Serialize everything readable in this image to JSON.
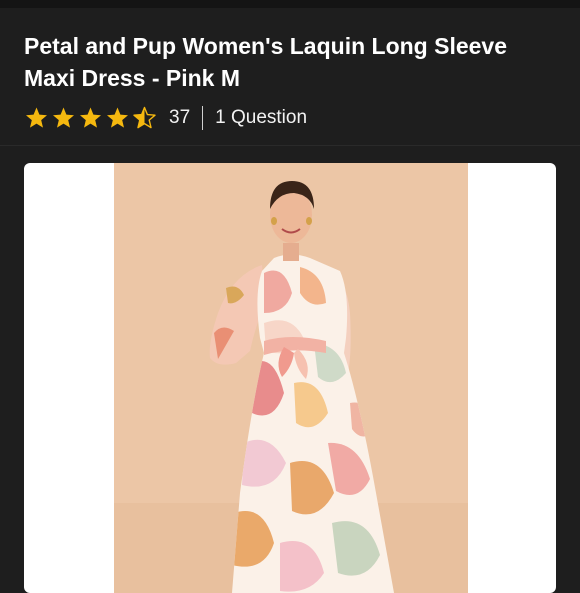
{
  "product": {
    "title": "Petal and Pup Women's Laquin Long Sleeve Maxi Dress - Pink M",
    "rating_stars": 4.5,
    "rating_count": "37",
    "questions": "1 Question"
  },
  "image": {
    "alt": "Model wearing a long sleeve maxi dress with a pink, orange and sage abstract print, tied at the waist"
  },
  "colors": {
    "background": "#1e1e1e",
    "star": "#f5b80f",
    "photo_backdrop": "#ecc6a6",
    "card": "#ffffff"
  },
  "icons": [
    "star-full-icon",
    "star-half-icon"
  ]
}
